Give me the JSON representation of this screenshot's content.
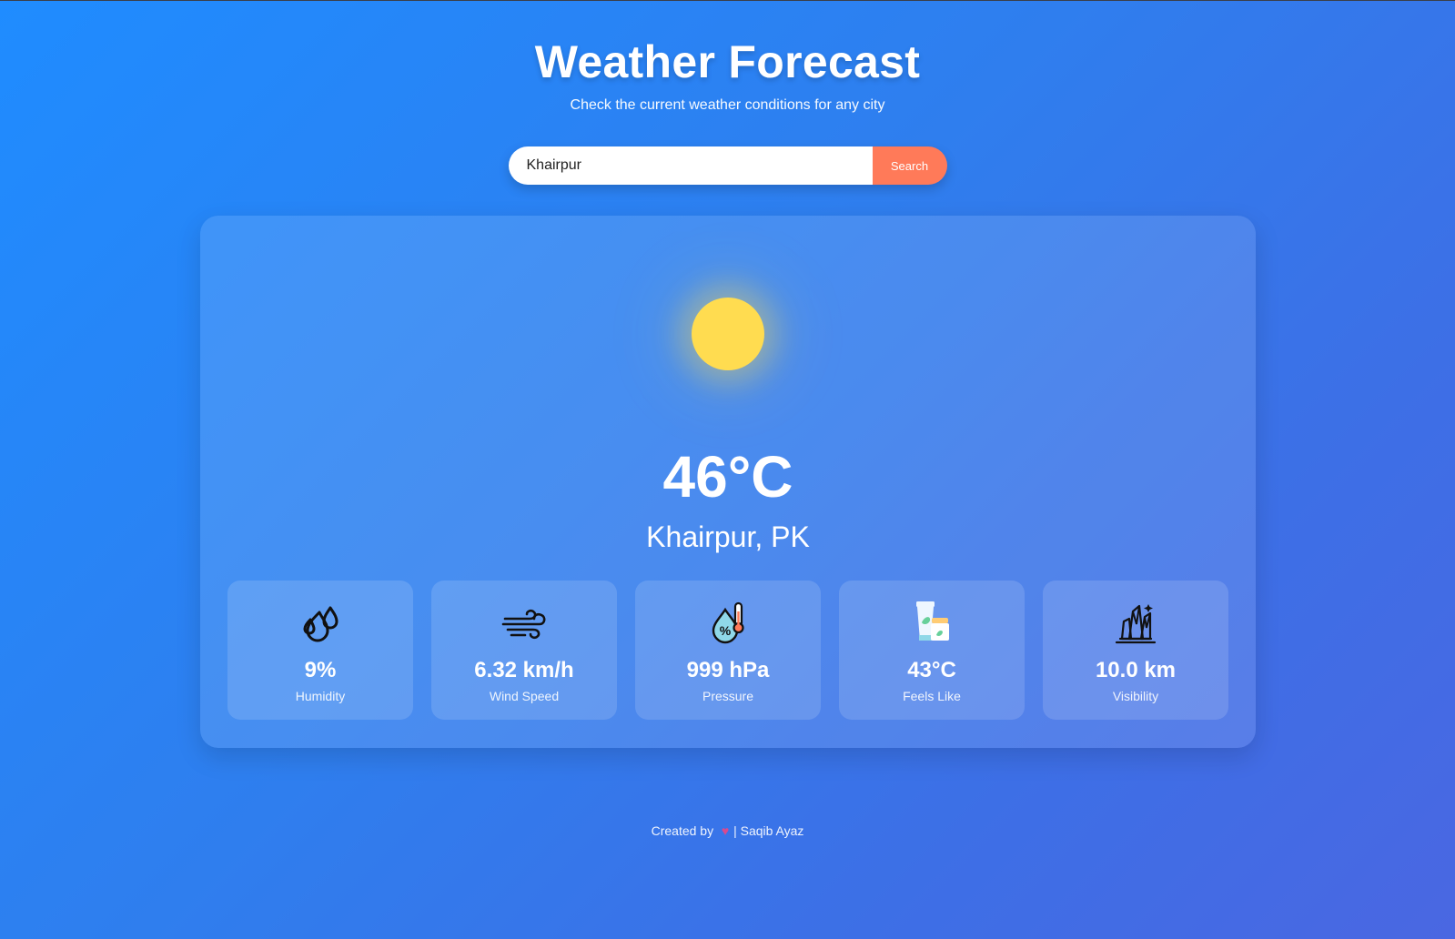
{
  "header": {
    "title": "Weather Forecast",
    "subtitle": "Check the current weather conditions for any city"
  },
  "search": {
    "value": "Khairpur",
    "button_label": "Search"
  },
  "weather": {
    "icon": "sun-icon",
    "temperature": "46°C",
    "location": "Khairpur, PK",
    "stats": [
      {
        "icon": "humidity-icon",
        "value": "9%",
        "label": "Humidity"
      },
      {
        "icon": "wind-icon",
        "value": "6.32 km/h",
        "label": "Wind Speed"
      },
      {
        "icon": "pressure-icon",
        "value": "999 hPa",
        "label": "Pressure"
      },
      {
        "icon": "feels-like-icon",
        "value": "43°C",
        "label": "Feels Like"
      },
      {
        "icon": "visibility-icon",
        "value": "10.0 km",
        "label": "Visibility"
      }
    ]
  },
  "footer": {
    "prefix": "Created by",
    "author": "| Saqib Ayaz"
  },
  "colors": {
    "accent": "#ff7a59",
    "sun": "#ffdc50",
    "background_start": "#1f8cff",
    "background_end": "#4a67e2"
  }
}
